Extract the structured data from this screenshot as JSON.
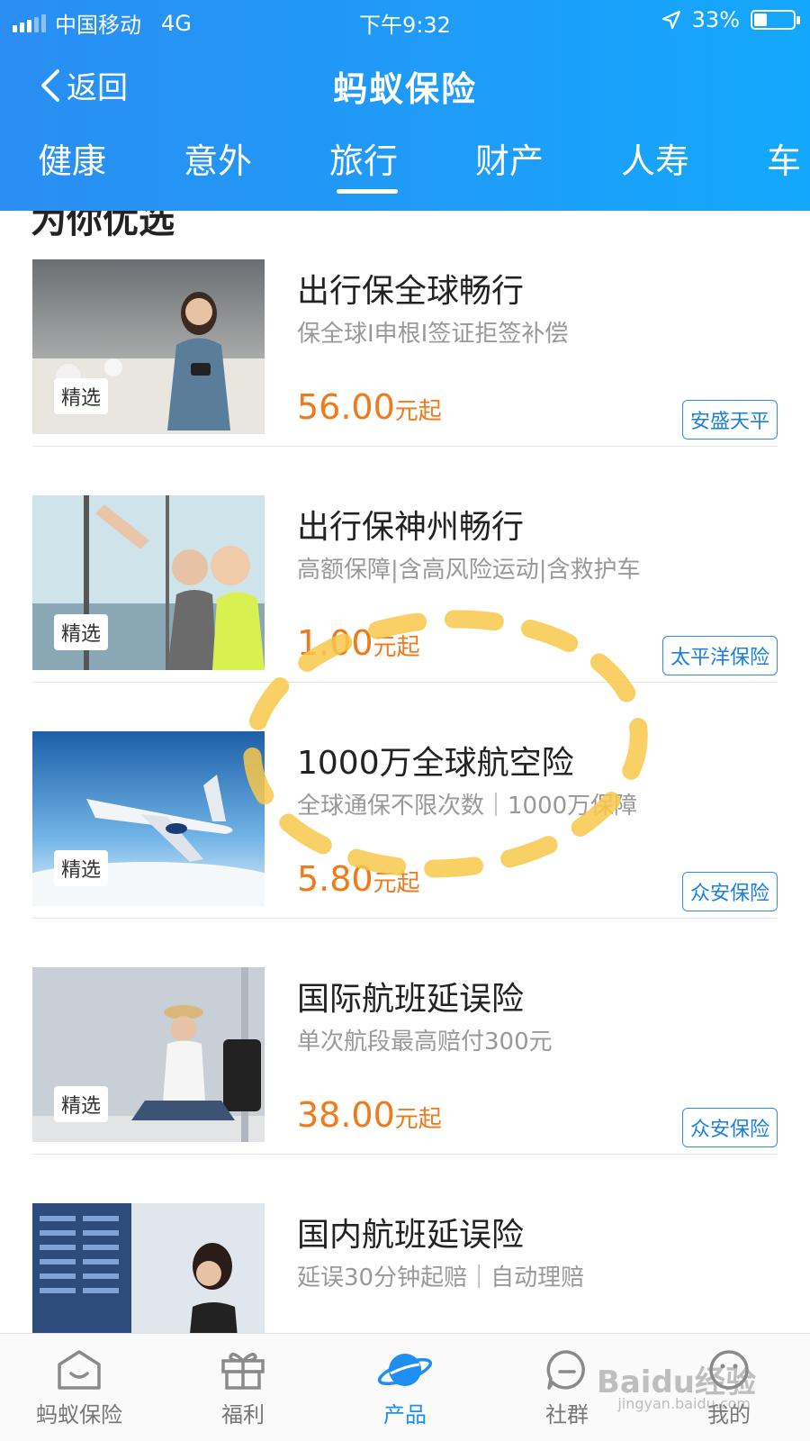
{
  "status_bar": {
    "carrier": "中国移动",
    "network": "4G",
    "time": "下午9:32",
    "battery": "33%",
    "battery_level": 0.33
  },
  "nav": {
    "back_label": "返回",
    "title": "蚂蚁保险"
  },
  "tabs": [
    "健康",
    "意外",
    "旅行",
    "财产",
    "人寿",
    "车"
  ],
  "active_tab": "旅行",
  "section_heading": "为你优选",
  "thumb_badge": "精选",
  "products": [
    {
      "title": "出行保全球畅行",
      "subtitle": "保全球I申根I签证拒签补偿",
      "price": "56.00",
      "price_suffix": "元起",
      "brand": "安盛天平"
    },
    {
      "title": "出行保神州畅行",
      "subtitle": "高额保障|含高风险运动|含救护车",
      "price": "1.00",
      "price_suffix": "元起",
      "brand": "太平洋保险"
    },
    {
      "title": "1000万全球航空险",
      "subtitle": "全球通保不限次数｜1000万保障",
      "price": "5.80",
      "price_suffix": "元起",
      "brand": "众安保险"
    },
    {
      "title": "国际航班延误险",
      "subtitle": "单次航段最高赔付300元",
      "price": "38.00",
      "price_suffix": "元起",
      "brand": "众安保险"
    },
    {
      "title": "国内航班延误险",
      "subtitle": "延误30分钟起赔｜自动理赔",
      "price": "",
      "price_suffix": "",
      "brand": ""
    }
  ],
  "tabbar": [
    {
      "label": "蚂蚁保险",
      "icon": "home-icon"
    },
    {
      "label": "福利",
      "icon": "gift-icon"
    },
    {
      "label": "产品",
      "icon": "planet-icon"
    },
    {
      "label": "社群",
      "icon": "chat-bubble-icon"
    },
    {
      "label": "我的",
      "icon": "profile-icon"
    }
  ],
  "colors": {
    "header": "#1e9df8",
    "price": "#f07a1a",
    "brand_border": "#2b8be8",
    "active_tab": "#1e8ff0",
    "annotation": "#f8c84a"
  },
  "watermark": {
    "text": "Baidu经验",
    "sub": "jingyan.baidu.com"
  }
}
